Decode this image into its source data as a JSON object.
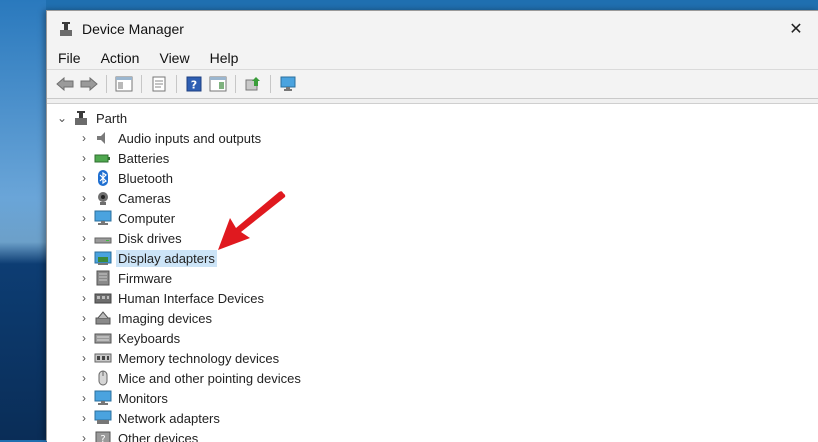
{
  "window": {
    "title": "Device Manager",
    "close_glyph": "✕"
  },
  "menu": [
    "File",
    "Action",
    "View",
    "Help"
  ],
  "toolbar": {
    "buttons": [
      "back-icon",
      "forward-icon",
      "show-hide-tree-icon",
      "properties-icon",
      "help-icon",
      "action-pane-icon",
      "update-driver-icon",
      "scan-hardware-icon"
    ]
  },
  "tree": {
    "root": "Parth",
    "items": [
      {
        "label": "Audio inputs and outputs",
        "icon": "speaker-icon"
      },
      {
        "label": "Batteries",
        "icon": "battery-icon"
      },
      {
        "label": "Bluetooth",
        "icon": "bluetooth-icon"
      },
      {
        "label": "Cameras",
        "icon": "camera-icon"
      },
      {
        "label": "Computer",
        "icon": "computer-icon"
      },
      {
        "label": "Disk drives",
        "icon": "disk-drive-icon"
      },
      {
        "label": "Display adapters",
        "icon": "display-adapter-icon",
        "selected": true
      },
      {
        "label": "Firmware",
        "icon": "firmware-icon"
      },
      {
        "label": "Human Interface Devices",
        "icon": "hid-icon"
      },
      {
        "label": "Imaging devices",
        "icon": "imaging-icon"
      },
      {
        "label": "Keyboards",
        "icon": "keyboard-icon"
      },
      {
        "label": "Memory technology devices",
        "icon": "memory-icon"
      },
      {
        "label": "Mice and other pointing devices",
        "icon": "mouse-icon"
      },
      {
        "label": "Monitors",
        "icon": "monitor-icon"
      },
      {
        "label": "Network adapters",
        "icon": "network-icon"
      },
      {
        "label": "Other devices",
        "icon": "other-devices-icon"
      }
    ]
  },
  "colors": {
    "selection": "#cce4f7",
    "annotation_arrow": "#e0191f"
  }
}
